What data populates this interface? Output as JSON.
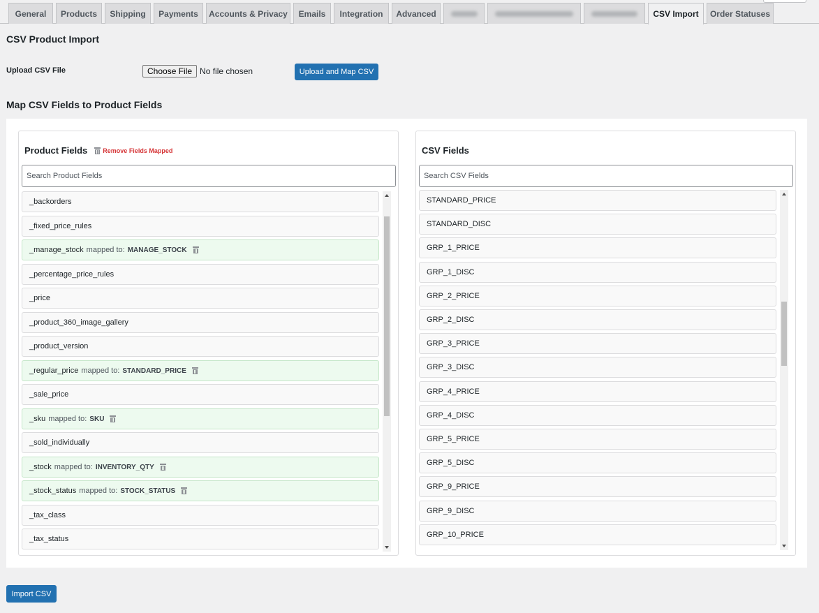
{
  "tabs": [
    {
      "label": "General"
    },
    {
      "label": "Products"
    },
    {
      "label": "Shipping"
    },
    {
      "label": "Payments"
    },
    {
      "label": "Accounts & Privacy"
    },
    {
      "label": "Emails"
    },
    {
      "label": "Integration"
    },
    {
      "label": "Advanced"
    },
    {
      "label": "CSV Import",
      "active": true
    },
    {
      "label": "Order Statuses"
    }
  ],
  "page": {
    "title": "CSV Product Import",
    "upload_label": "Upload CSV File",
    "choose_file_label": "Choose File",
    "no_file_text": "No file chosen",
    "upload_button": "Upload and Map CSV",
    "map_title": "Map CSV Fields to Product Fields",
    "import_button": "Import CSV"
  },
  "product_fields": {
    "heading": "Product Fields",
    "remove_link": "Remove Fields Mapped",
    "search_placeholder": "Search Product Fields",
    "mapped_text": "mapped to:",
    "items": [
      {
        "name": "_backorders"
      },
      {
        "name": "_fixed_price_rules"
      },
      {
        "name": "_manage_stock",
        "mapped_to": "MANAGE_STOCK"
      },
      {
        "name": "_percentage_price_rules"
      },
      {
        "name": "_price"
      },
      {
        "name": "_product_360_image_gallery"
      },
      {
        "name": "_product_version"
      },
      {
        "name": "_regular_price",
        "mapped_to": "STANDARD_PRICE"
      },
      {
        "name": "_sale_price"
      },
      {
        "name": "_sku",
        "mapped_to": "SKU"
      },
      {
        "name": "_sold_individually"
      },
      {
        "name": "_stock",
        "mapped_to": "INVENTORY_QTY"
      },
      {
        "name": "_stock_status",
        "mapped_to": "STOCK_STATUS"
      },
      {
        "name": "_tax_class"
      },
      {
        "name": "_tax_status"
      }
    ]
  },
  "csv_fields": {
    "heading": "CSV Fields",
    "search_placeholder": "Search CSV Fields",
    "items": [
      "STANDARD_PRICE",
      "STANDARD_DISC",
      "GRP_1_PRICE",
      "GRP_1_DISC",
      "GRP_2_PRICE",
      "GRP_2_DISC",
      "GRP_3_PRICE",
      "GRP_3_DISC",
      "GRP_4_PRICE",
      "GRP_4_DISC",
      "GRP_5_PRICE",
      "GRP_5_DISC",
      "GRP_9_PRICE",
      "GRP_9_DISC",
      "GRP_10_PRICE"
    ]
  },
  "colors": {
    "primary": "#2271b1",
    "mapped_bg": "#edfaef",
    "danger": "#d63638"
  }
}
